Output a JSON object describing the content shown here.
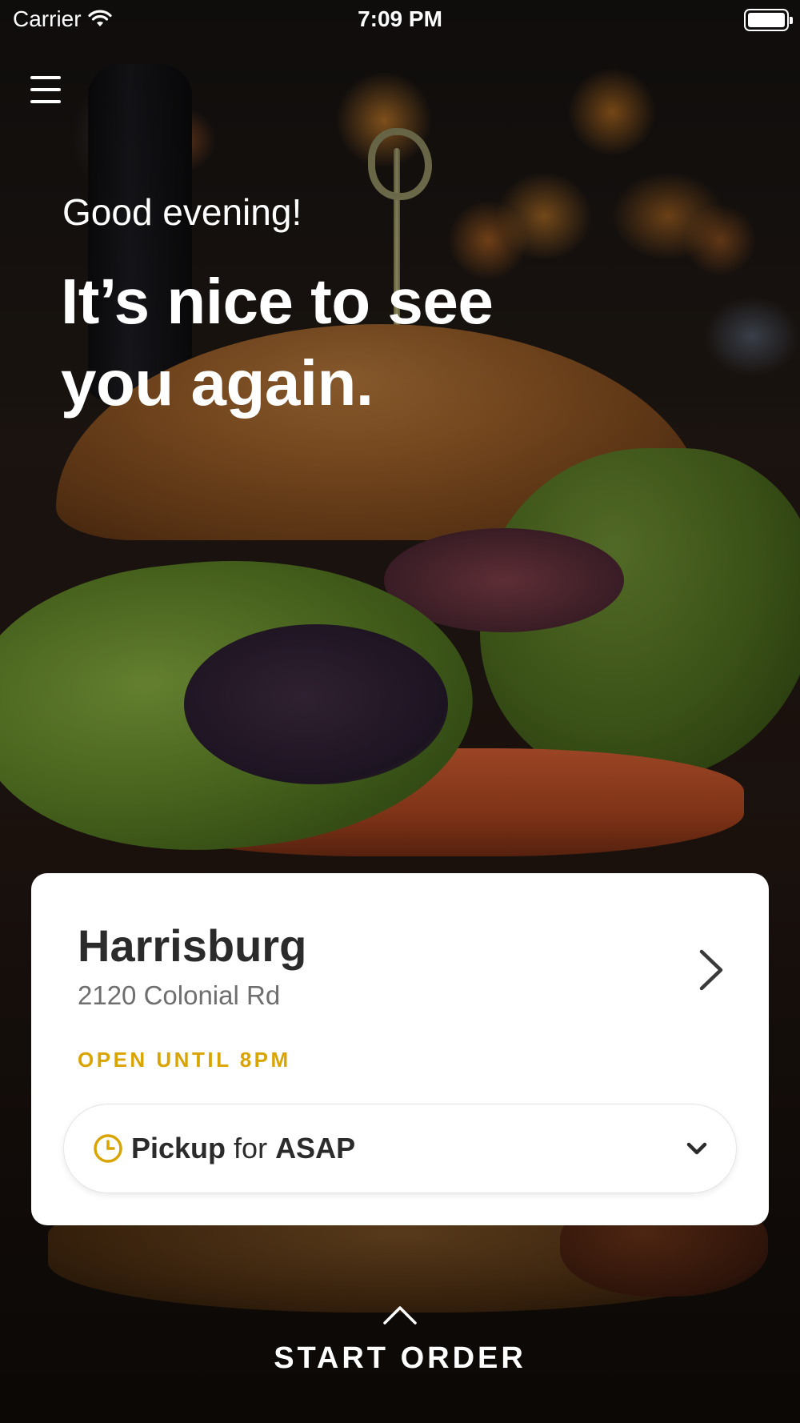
{
  "status_bar": {
    "carrier": "Carrier",
    "time": "7:09 PM"
  },
  "icons": {
    "menu": "hamburger-icon",
    "wifi": "wifi-icon",
    "battery": "battery-icon",
    "location_chevron": "chevron-right-icon",
    "clock": "clock-icon",
    "dropdown": "chevron-down-icon",
    "start_order": "chevron-up-icon"
  },
  "hero": {
    "greeting": "Good evening!",
    "headline": "It’s nice to see you again."
  },
  "location": {
    "name": "Harrisburg",
    "address": "2120 Colonial Rd",
    "status": "OPEN UNTIL 8PM"
  },
  "order_options": {
    "mode": "Pickup",
    "connector": "for",
    "time": "ASAP"
  },
  "start_order": {
    "label": "START ORDER"
  },
  "colors": {
    "accent": "#d9a400",
    "card_background": "#ffffff",
    "title_text": "#2b2b2b",
    "secondary_text": "#6e6e6e"
  }
}
